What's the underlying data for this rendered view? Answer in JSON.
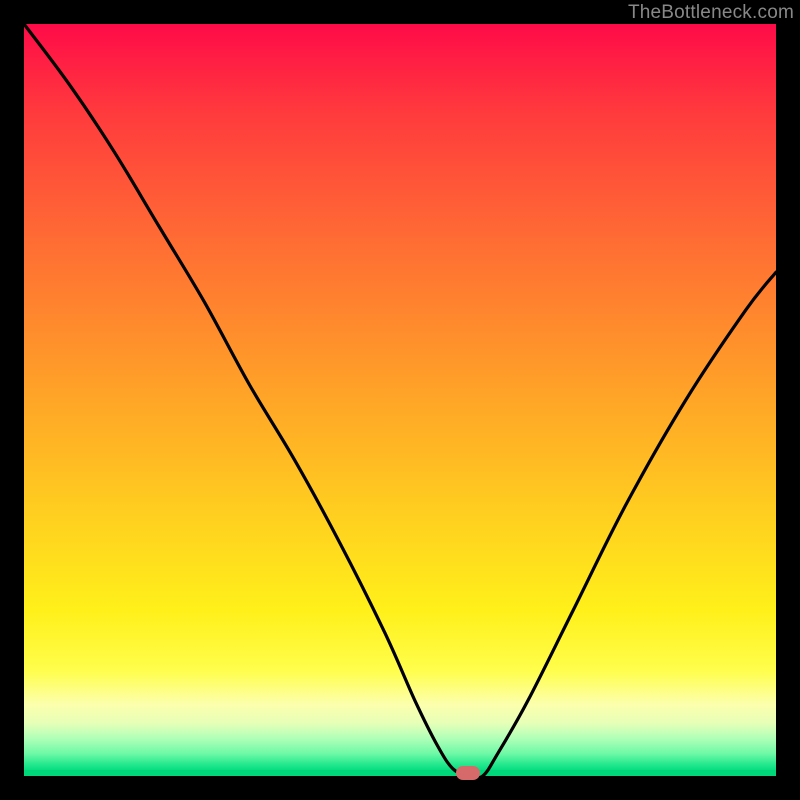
{
  "attribution": {
    "text": "TheBottleneck.com"
  },
  "marker": {
    "x_pct": 59,
    "y_pct": 0
  },
  "chart_data": {
    "type": "line",
    "title": "",
    "xlabel": "",
    "ylabel": "",
    "xlim": [
      0,
      100
    ],
    "ylim": [
      0,
      100
    ],
    "grid": false,
    "legend": false,
    "background": "gradient red→yellow→green (vertical)",
    "series": [
      {
        "name": "bottleneck-curve",
        "x": [
          0,
          6,
          12,
          18,
          24,
          30,
          36,
          42,
          48,
          52,
          55,
          57,
          59,
          61,
          63,
          67,
          73,
          80,
          88,
          96,
          100
        ],
        "y": [
          100,
          92,
          83,
          73,
          63,
          52,
          42,
          31,
          19,
          10,
          4,
          1,
          0,
          0,
          3,
          10,
          22,
          36,
          50,
          62,
          67
        ]
      }
    ],
    "annotations": [
      {
        "type": "lozenge-marker",
        "x": 59,
        "y": 0,
        "color": "#d66a6a"
      }
    ]
  }
}
